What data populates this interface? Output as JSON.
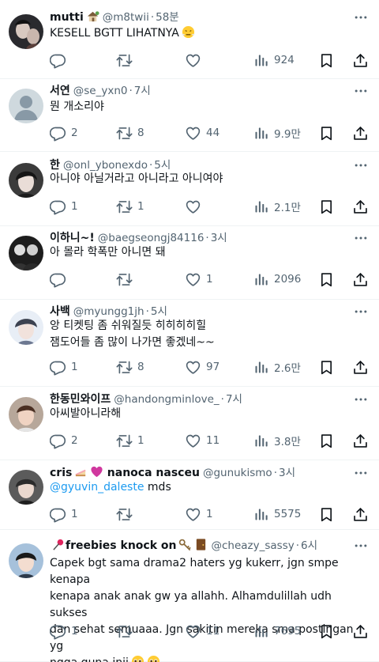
{
  "colors": {
    "text": "#0f1419",
    "secondary": "#536471",
    "link": "#1d9bf0",
    "divider": "#eff3f4"
  },
  "icons": {
    "reply": "reply-icon",
    "retweet": "retweet-icon",
    "like": "heart-icon",
    "views": "views-icon",
    "bookmark": "bookmark-icon",
    "share": "share-icon",
    "more": "more-icon"
  },
  "tweets": [
    {
      "name": "mutti",
      "handle": "@m8twii",
      "time": "58분",
      "text": "KESELL BGTT LIHATNYA",
      "replies": "",
      "retweets": "",
      "likes": "",
      "views": "924"
    },
    {
      "name": "서연",
      "handle": "@se_yxn0",
      "time": "7시",
      "text": "뭔 개소리야",
      "replies": "2",
      "retweets": "8",
      "likes": "44",
      "views": "9.9만"
    },
    {
      "name": "한",
      "handle": "@onl_ybonexdo",
      "time": "5시",
      "text": "아니야 아닐거라고 아니라고 아니여야",
      "replies": "1",
      "retweets": "1",
      "likes": "",
      "views": "2.1만"
    },
    {
      "name": "이하니~!",
      "handle": "@baegseongj84116",
      "time": "3시",
      "text": "아 몰라 학폭만 아니면 돼",
      "replies": "",
      "retweets": "",
      "likes": "1",
      "views": "2096"
    },
    {
      "name": "사백",
      "handle": "@myungg1jh",
      "time": "5시",
      "text": "앙 티켓팅 좀 쉬워질듯 히히히히힐\n잼도어들 좀 많이 나가면 좋겠네~~",
      "replies": "1",
      "retweets": "8",
      "likes": "97",
      "views": "2.6만"
    },
    {
      "name": "한동민와이프",
      "handle": "@handongminlove_",
      "time": "7시",
      "text": "아씨발아니라해",
      "replies": "2",
      "retweets": "1",
      "likes": "11",
      "views": "3.8만"
    },
    {
      "name": "cris",
      "name2": "nanoca nasceu",
      "handle": "@gunukismo",
      "time": "3시",
      "mention": "@gyuvin_daleste",
      "text": " mds",
      "replies": "1",
      "retweets": "",
      "likes": "1",
      "views": "5575"
    },
    {
      "name": "freebies knock on",
      "handle": "@cheazy_sassy",
      "time": "6시",
      "text": "Capek bgt sama drama2 haters yg kukerr, jgn smpe kenapa\nkenapa anak anak gw ya allahh. Alhamdulillah udh sukses\ndan sehat semuaaa. Jgn sakitin mereka sma postingan yg\nngga guna inii",
      "replies": "1",
      "retweets": "",
      "likes": "11",
      "views": "7695"
    }
  ]
}
